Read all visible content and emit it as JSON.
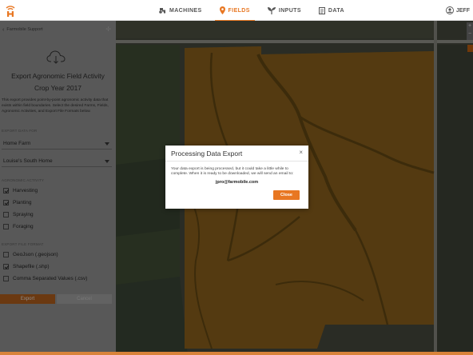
{
  "nav": {
    "items": [
      {
        "label": "MACHINES",
        "icon": "tractor-icon"
      },
      {
        "label": "FIELDS",
        "icon": "map-pin-icon",
        "active": true
      },
      {
        "label": "INPUTS",
        "icon": "seedling-icon"
      },
      {
        "label": "DATA",
        "icon": "document-icon"
      }
    ],
    "user": "JEFF",
    "accent": "#e87722"
  },
  "sidebar": {
    "back_label": "Farmobile Support",
    "title": "Export Agronomic Field Activity",
    "subtitle": "Crop Year 2017",
    "description": "This export provides point-by-point agronomic activity data that exists within field boundaries. Select the desired Farms, Fields, Agronomic Activities, and Export File Formats below.",
    "export_for_label": "EXPORT DATA FOR",
    "farm_select": "Home Farm",
    "field_select": "Louise's South Home",
    "activity_label": "AGRONOMIC ACTIVITY",
    "activities": [
      {
        "label": "Harvesting",
        "checked": true
      },
      {
        "label": "Planting",
        "checked": true
      },
      {
        "label": "Spraying",
        "checked": false
      },
      {
        "label": "Foraging",
        "checked": false
      }
    ],
    "format_label": "EXPORT FILE FORMAT",
    "formats": [
      {
        "label": "GeoJson (.geojson)",
        "checked": false
      },
      {
        "label": "Shapefile (.shp)",
        "checked": true
      },
      {
        "label": "Comma Separated Values (.csv)",
        "checked": false
      }
    ],
    "export_button": "Export",
    "cancel_button": "Cancel"
  },
  "modal": {
    "title": "Processing Data Export",
    "close": "×",
    "message": "Your data export is being processed, but it could take a little while to complete. When it is ready to be downloaded, we will send an email to:",
    "email": "jpro@farmobile.com",
    "button": "Close"
  },
  "map": {
    "zoom_in": "+",
    "zoom_out": "−"
  }
}
